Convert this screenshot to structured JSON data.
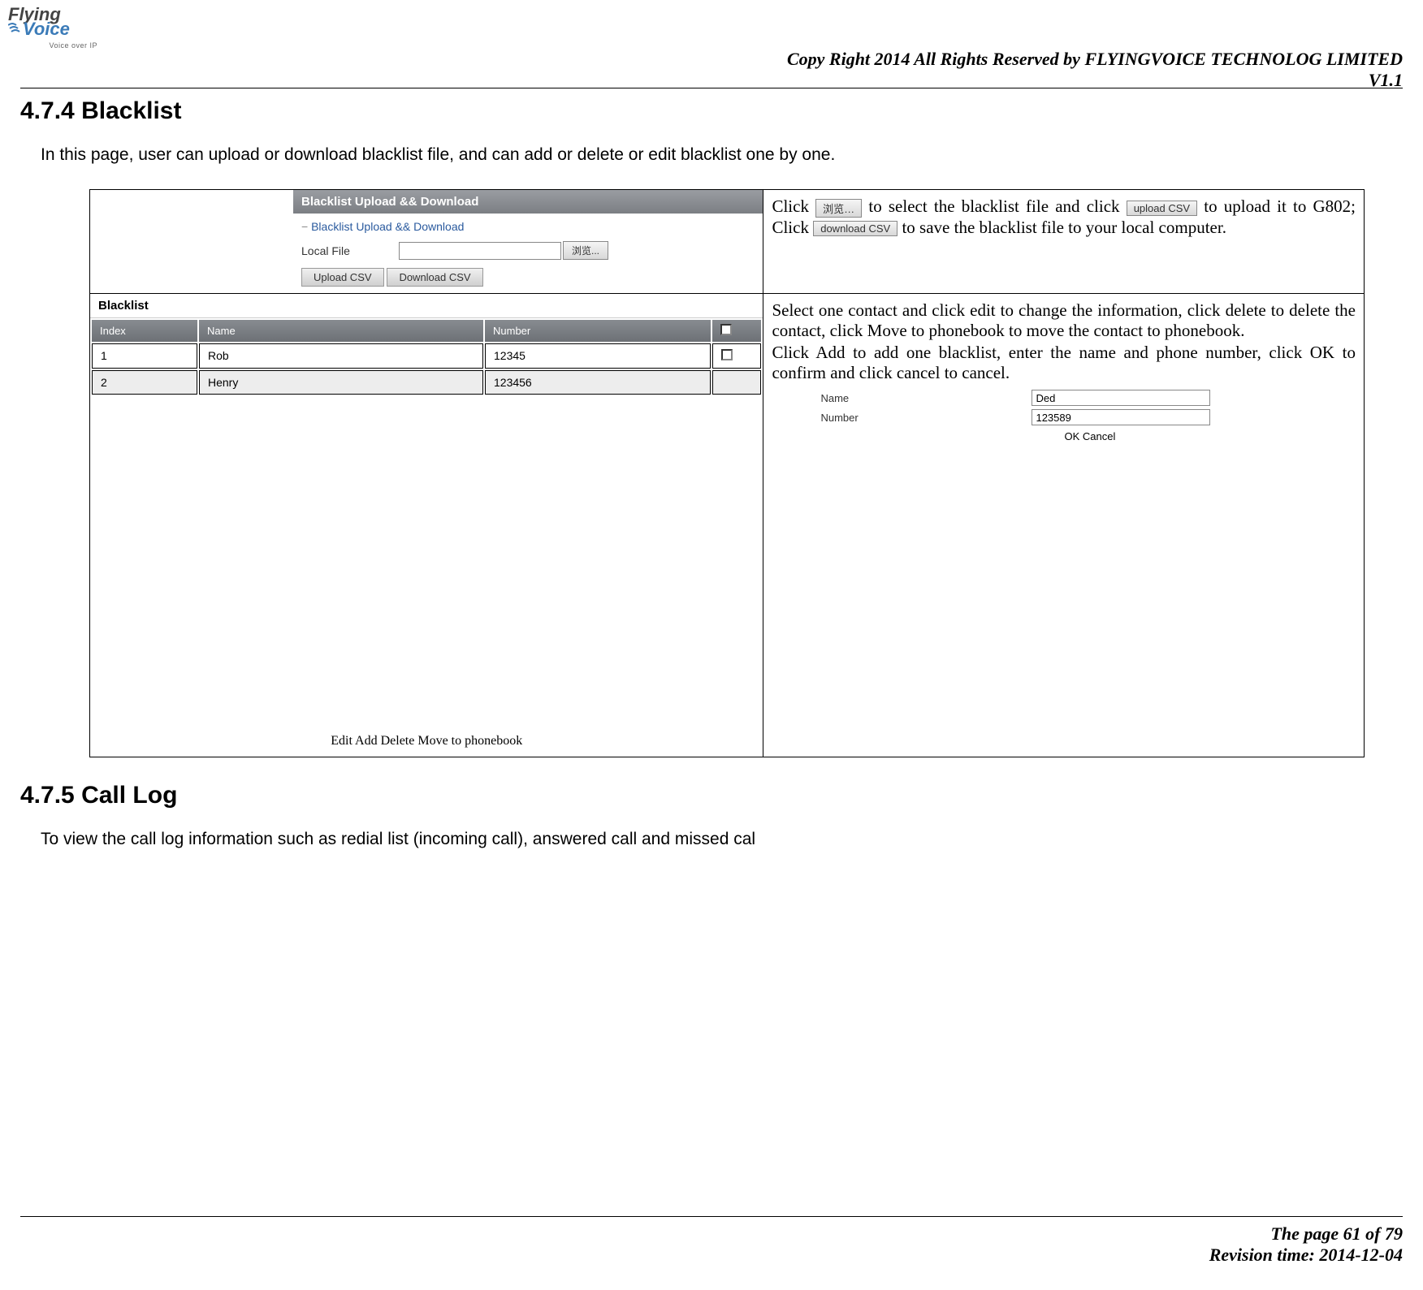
{
  "logo": {
    "line1a": "Flying",
    "line1b": "Voice",
    "sub": "Voice over IP"
  },
  "header": {
    "copyright": "Copy Right 2014 All Rights Reserved by FLYINGVOICE TECHNOLOG LIMITED",
    "version": "V1.1"
  },
  "section1": {
    "number": "4.7.4",
    "title": "Blacklist",
    "intro": "In this page, user can upload or download blacklist file, and can add or delete or edit blacklist one by one."
  },
  "panel1": {
    "header": "Blacklist Upload && Download",
    "sublink": "Blacklist Upload && Download",
    "local_file_label": "Local File",
    "browse_btn": "浏览...",
    "upload_btn": "Upload CSV",
    "download_btn": "Download CSV"
  },
  "desc1": {
    "p1a": "Click",
    "browse_btn": "浏览…",
    "p1b": " to select the blacklist file and click ",
    "upload_btn": "upload CSV",
    "p1c": " to upload it to G802; Click ",
    "download_btn": "download CSV",
    "p1d": " to save the blacklist file to your local computer."
  },
  "panel2": {
    "title": "Blacklist",
    "cols": {
      "index": "Index",
      "name": "Name",
      "number": "Number"
    },
    "rows": [
      {
        "index": "1",
        "name": "Rob",
        "number": "12345"
      },
      {
        "index": "2",
        "name": "Henry",
        "number": "123456"
      }
    ],
    "buttons": {
      "edit": "Edit",
      "add": "Add",
      "delete": "Delete",
      "move": "Move to phonebook"
    }
  },
  "desc2": {
    "p1": "Select one contact and click edit to change the information, click delete to delete the contact, click Move to phonebook to move the contact to phonebook.",
    "p2": "Click Add to add one blacklist, enter the name and phone number, click OK to confirm and click cancel to cancel.",
    "form": {
      "name_label": "Name",
      "name_value": "Ded",
      "number_label": "Number",
      "number_value": "123589",
      "ok": "OK",
      "cancel": "Cancel"
    }
  },
  "section2": {
    "number": "4.7.5",
    "title": "Call Log",
    "intro": "To view the call log information such as redial list (incoming call), answered call and missed cal"
  },
  "footer": {
    "page": "The page 61 of 79",
    "revision": "Revision time: 2014-12-04"
  }
}
